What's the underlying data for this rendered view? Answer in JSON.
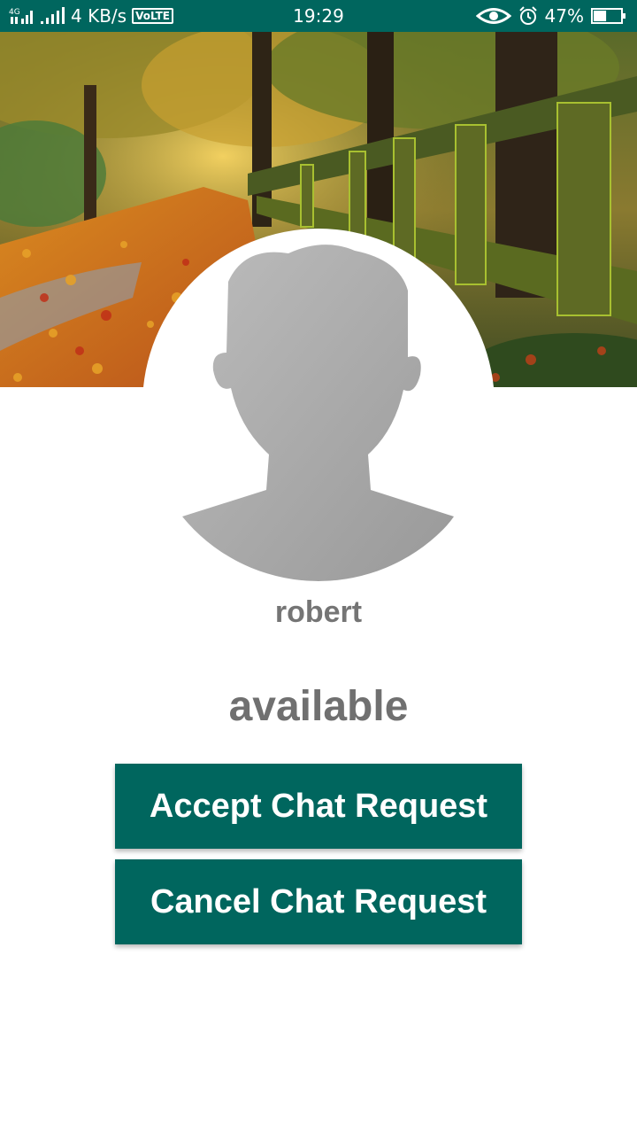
{
  "status_bar": {
    "network": "4G",
    "speed": "4 KB/s",
    "volte": "VoLTE",
    "time": "19:29",
    "battery": "47%",
    "battery_level": 0.47,
    "icons": [
      "signal-icon",
      "signal-icon",
      "eye-icon",
      "alarm-icon",
      "battery-icon"
    ]
  },
  "profile": {
    "cover_image": "autumn-forest-path-photo",
    "avatar_image": "default-person-silhouette",
    "name": "robert",
    "status": "available"
  },
  "actions": {
    "accept_label": "Accept Chat Request",
    "cancel_label": "Cancel Chat Request"
  },
  "colors": {
    "primary": "#00665e",
    "text_gray": "#757575",
    "background": "#ffffff"
  }
}
